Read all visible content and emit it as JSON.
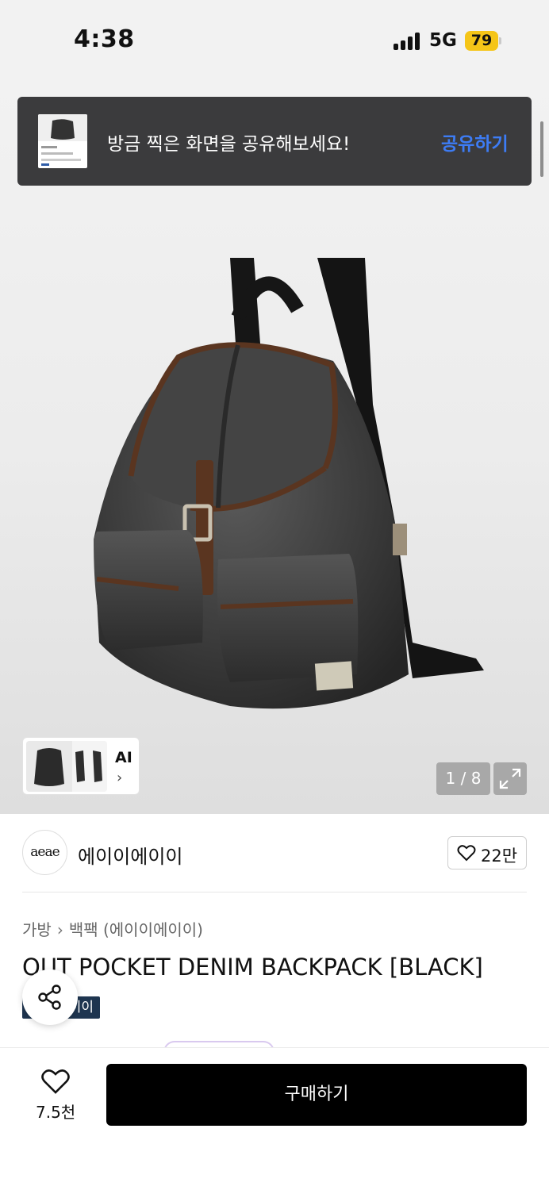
{
  "status_bar": {
    "time": "4:38",
    "network": "5G",
    "battery": "79"
  },
  "toast": {
    "message": "방금 찍은 화면을 공유해보세요!",
    "action": "공유하기"
  },
  "gallery": {
    "thumb_label": "AI",
    "counter": "1 / 8"
  },
  "brand": {
    "logo_text": "aeae",
    "name": "에이이에이이",
    "like_count": "22만"
  },
  "breadcrumb": {
    "category": "가방",
    "subcategory": "백팩 (에이이에이이)"
  },
  "product": {
    "title": "OUT POCKET DENIM BACKPACK [BLACK]",
    "brand_tag": "에이이"
  },
  "bottom_bar": {
    "like_count": "7.5천",
    "buy_label": "구매하기"
  },
  "icons": [
    "signal-icon",
    "battery-icon",
    "chevron-right-icon",
    "expand-icon",
    "heart-icon",
    "share-icon"
  ]
}
